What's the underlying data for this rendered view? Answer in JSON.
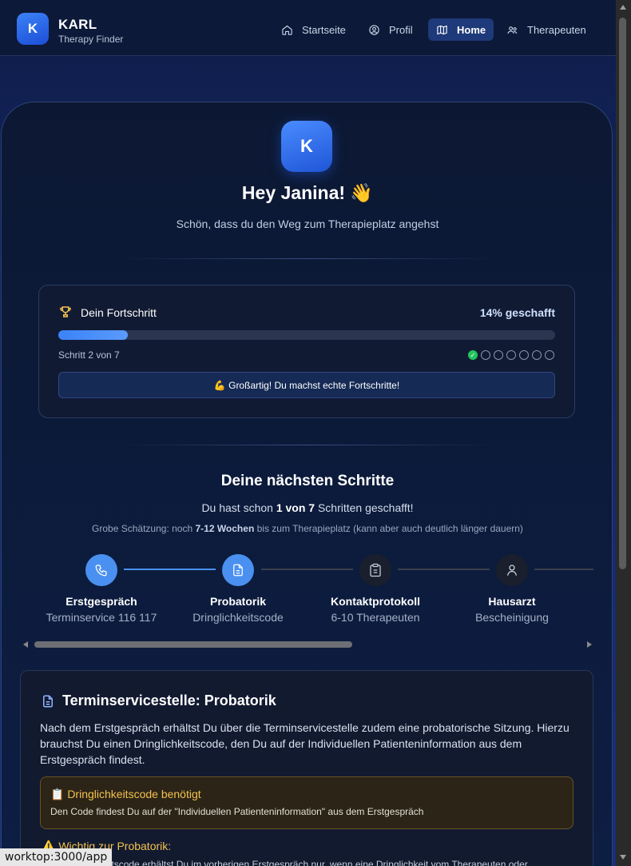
{
  "brand": {
    "logo_letter": "K",
    "name": "KARL",
    "subtitle": "Therapy Finder"
  },
  "nav": [
    {
      "label": "Startseite",
      "icon": "home-icon"
    },
    {
      "label": "Profil",
      "icon": "user-circle-icon"
    },
    {
      "label": "Home",
      "icon": "map-icon",
      "active": true
    },
    {
      "label": "Therapeuten",
      "icon": "users-icon"
    }
  ],
  "hero": {
    "logo_letter": "K",
    "title": "Hey Janina! 👋",
    "subtitle": "Schön, dass du den Weg zum Therapieplatz angehst"
  },
  "progress": {
    "title": "Dein Fortschritt",
    "percent_label": "14% geschafft",
    "percent": 14,
    "step_label": "Schritt 2 von 7",
    "dots_total": 7,
    "dots_done": 1,
    "motivation": "💪 Großartig! Du machst echte Fortschritte!"
  },
  "steps": {
    "title": "Deine nächsten Schritte",
    "sub_prefix": "Du hast schon ",
    "sub_bold": "1 von 7",
    "sub_suffix": " Schritten geschafft!",
    "est_prefix": "Grobe Schätzung: noch ",
    "est_bold": "7-12 Wochen",
    "est_suffix": " bis zum Therapieplatz (kann aber auch deutlich länger dauern)",
    "items": [
      {
        "name": "Erstgespräch",
        "desc": "Terminservice 116 117",
        "icon": "phone-icon",
        "state": "active"
      },
      {
        "name": "Probatorik",
        "desc": "Dringlichkeitscode",
        "icon": "document-icon",
        "state": "active"
      },
      {
        "name": "Kontaktprotokoll",
        "desc": "6-10 Therapeuten",
        "icon": "clipboard-icon",
        "state": "inactive"
      },
      {
        "name": "Hausarzt",
        "desc": "Bescheinigung",
        "icon": "person-icon",
        "state": "inactive"
      }
    ]
  },
  "detail": {
    "title": "Terminservicestelle: Probatorik",
    "text": "Nach dem Erstgespräch erhältst Du über die Terminservicestelle zudem eine probatorische Sitzung. Hierzu brauchst Du einen Dringlichkeitscode, den Du auf der Individuellen Patienteninformation aus dem Erstgespräch findest.",
    "warn_title": "📋 Dringlichkeitscode benötigt",
    "warn_text": "Den Code findest Du auf der \"Individuellen Patienteninformation\" aus dem Erstgespräch",
    "note_title": "⚠️ Wichtig zur Probatorik:",
    "note_cut": "Den Dringlichkeitscode erhältst Du im vorherigen Erstgespräch nur, wenn eine Dringlichkeit vom Therapeuten oder"
  },
  "status_url": "worktop:3000/app",
  "colors": {
    "accent": "#3b82f6",
    "success": "#22c55e",
    "warning": "#f4c24e"
  }
}
